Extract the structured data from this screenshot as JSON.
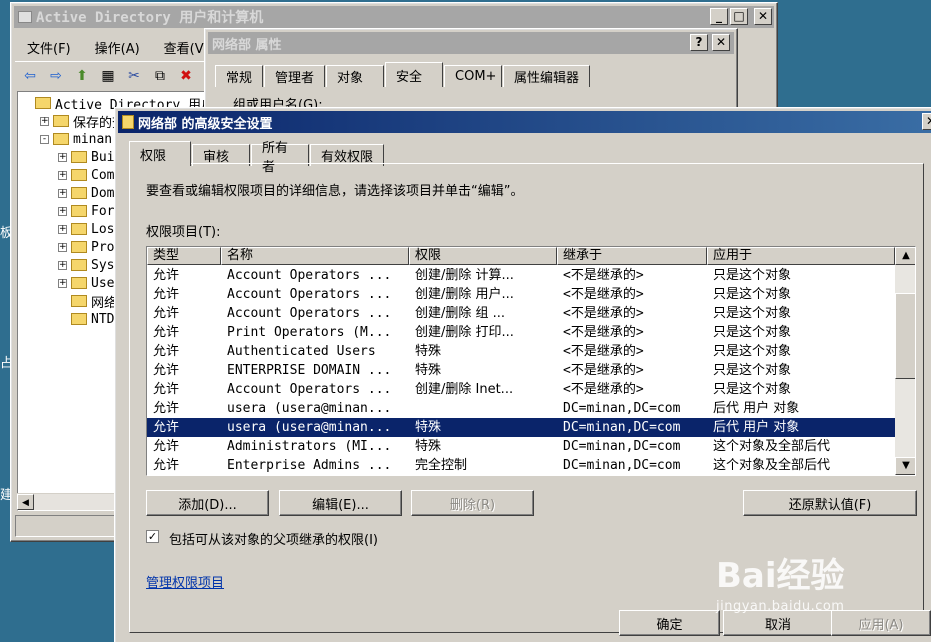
{
  "desktop": {
    "edge_chars": [
      "板",
      "占",
      "建"
    ]
  },
  "mmc": {
    "title": "Active Directory 用户和计算机",
    "menu": [
      "文件(F)",
      "操作(A)",
      "查看(V"
    ],
    "tree": [
      {
        "label": "Active Directory 用户",
        "indent": 0,
        "pm": ""
      },
      {
        "label": "保存的查",
        "indent": 1,
        "pm": "+"
      },
      {
        "label": "minan.c",
        "indent": 1,
        "pm": "-"
      },
      {
        "label": "Built",
        "indent": 2,
        "pm": "+"
      },
      {
        "label": "Compu",
        "indent": 2,
        "pm": "+"
      },
      {
        "label": "Domai",
        "indent": 2,
        "pm": "+"
      },
      {
        "label": "Forei",
        "indent": 2,
        "pm": "+"
      },
      {
        "label": "LostA",
        "indent": 2,
        "pm": "+"
      },
      {
        "label": "Progr",
        "indent": 2,
        "pm": "+"
      },
      {
        "label": "Syste",
        "indent": 2,
        "pm": "+"
      },
      {
        "label": "Users",
        "indent": 2,
        "pm": "+"
      },
      {
        "label": "网络部",
        "indent": 2,
        "pm": ""
      },
      {
        "label": "NTDS",
        "indent": 2,
        "pm": ""
      }
    ]
  },
  "props": {
    "title": "网络部 属性",
    "tabs": [
      "常规",
      "管理者",
      "对象",
      "安全",
      "COM+",
      "属性编辑器"
    ],
    "group_label": "组或用户名(G):"
  },
  "adv": {
    "title": "网络部 的高级安全设置",
    "tabs": [
      "权限",
      "审核",
      "所有者",
      "有效权限"
    ],
    "instruction": "要查看或编辑权限项目的详细信息，请选择该项目并单击“编辑”。",
    "entries_label": "权限项目(T):",
    "columns": [
      "类型",
      "名称",
      "权限",
      "继承于",
      "应用于"
    ],
    "rows": [
      [
        "允许",
        "Account Operators ...",
        "创建/删除 计算...",
        "<不是继承的>",
        "只是这个对象"
      ],
      [
        "允许",
        "Account Operators ...",
        "创建/删除 用户...",
        "<不是继承的>",
        "只是这个对象"
      ],
      [
        "允许",
        "Account Operators ...",
        "创建/删除 组 ...",
        "<不是继承的>",
        "只是这个对象"
      ],
      [
        "允许",
        "Print Operators (M...",
        "创建/删除 打印...",
        "<不是继承的>",
        "只是这个对象"
      ],
      [
        "允许",
        "Authenticated Users",
        "特殊",
        "<不是继承的>",
        "只是这个对象"
      ],
      [
        "允许",
        "ENTERPRISE DOMAIN ...",
        "特殊",
        "<不是继承的>",
        "只是这个对象"
      ],
      [
        "允许",
        "Account Operators ...",
        "创建/删除 Inet...",
        "<不是继承的>",
        "只是这个对象"
      ],
      [
        "允许",
        "usera (usera@minan...",
        "",
        "DC=minan,DC=com",
        "后代 用户 对象"
      ],
      [
        "允许",
        "usera (usera@minan...",
        "特殊",
        "DC=minan,DC=com",
        "后代 用户 对象"
      ],
      [
        "允许",
        "Administrators (MI...",
        "特殊",
        "DC=minan,DC=com",
        "这个对象及全部后代"
      ],
      [
        "允许",
        "Enterprise Admins ...",
        "完全控制",
        "DC=minan,DC=com",
        "这个对象及全部后代"
      ]
    ],
    "selected_row": 8,
    "buttons": {
      "add": "添加(D)...",
      "edit": "编辑(E)...",
      "remove": "删除(R)",
      "restore": "还原默认值(F)"
    },
    "inherit_checkbox": "包括可从该对象的父项继承的权限(I)",
    "inherit_checked": true,
    "manage_link": "管理权限项目",
    "bottom_buttons": {
      "ok": "确定",
      "cancel": "取消",
      "apply": "应用(A)"
    }
  },
  "watermark": {
    "brand": "Bai经验",
    "url": "jingyan.baidu.com"
  }
}
